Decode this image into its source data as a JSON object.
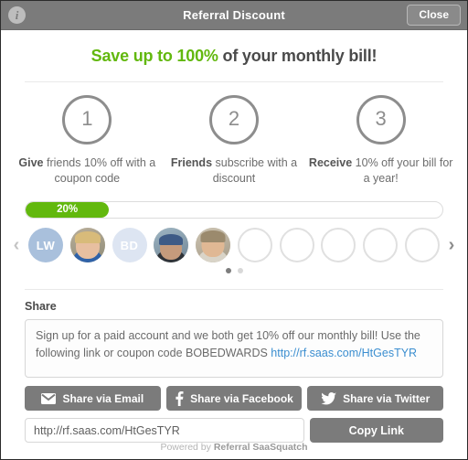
{
  "titlebar": {
    "info_icon": "info-icon",
    "title": "Referral Discount",
    "close_label": "Close"
  },
  "headline": {
    "green_part": "Save up to 100%",
    "rest_part": " of your monthly bill!"
  },
  "steps": [
    {
      "number": "1",
      "strong": "Give",
      "text": " friends 10% off with a coupon code"
    },
    {
      "number": "2",
      "strong": "Friends",
      "text": " subscribe with a discount"
    },
    {
      "number": "3",
      "strong": "Receive",
      "text": " 10% off your bill for a year!"
    }
  ],
  "progress": {
    "label": "20%",
    "percent": 20,
    "fill_color": "#62b80e",
    "track_color": "#ffffff"
  },
  "carousel": {
    "prev_icon": "chevron-left-icon",
    "next_icon": "chevron-right-icon",
    "avatars": [
      {
        "type": "initials",
        "label": "LW",
        "color": "#a9c0dc"
      },
      {
        "type": "photo",
        "label": ""
      },
      {
        "type": "initials",
        "label": "BD",
        "color": "#dde5f2"
      },
      {
        "type": "photo",
        "label": ""
      },
      {
        "type": "photo",
        "label": ""
      },
      {
        "type": "empty",
        "label": ""
      },
      {
        "type": "empty",
        "label": ""
      },
      {
        "type": "empty",
        "label": ""
      },
      {
        "type": "empty",
        "label": ""
      },
      {
        "type": "empty",
        "label": ""
      }
    ],
    "dots": [
      {
        "active": true
      },
      {
        "active": false
      }
    ]
  },
  "share": {
    "label": "Share",
    "message_text": "Sign up for a paid account and we both get 10% off our monthly bill! Use the following link or coupon code BOBEDWARDS ",
    "message_link": "http://rf.saas.com/HtGesTYR",
    "buttons": [
      {
        "icon": "email-icon",
        "label": "Share via Email"
      },
      {
        "icon": "facebook-icon",
        "label": "Share via Facebook"
      },
      {
        "icon": "twitter-icon",
        "label": "Share via Twitter"
      }
    ],
    "link_value": "http://rf.saas.com/HtGesTYR",
    "copy_label": "Copy Link"
  },
  "footer": {
    "prefix": "Powered by ",
    "brand": "Referral SaaSquatch"
  }
}
